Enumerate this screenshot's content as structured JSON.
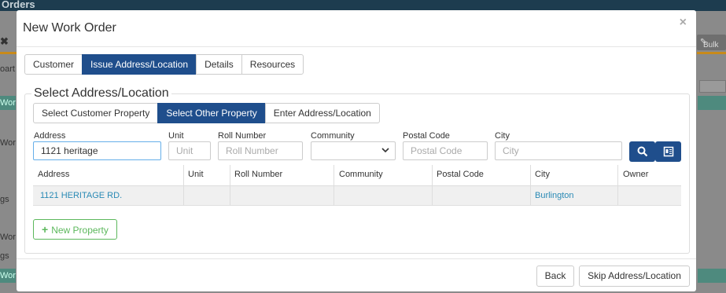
{
  "background": {
    "title_fragment": "Orders",
    "bulk_label": "Bulk",
    "left_fragments": [
      "oart",
      "Wor",
      "Wor",
      "gs",
      "Wor",
      "gs",
      "Wor",
      "Wor"
    ]
  },
  "modal": {
    "title": "New Work Order",
    "close_glyph": "×",
    "tabs": [
      {
        "label": "Customer",
        "active": false
      },
      {
        "label": "Issue Address/Location",
        "active": true
      },
      {
        "label": "Details",
        "active": false
      },
      {
        "label": "Resources",
        "active": false
      }
    ],
    "section_title": "Select Address/Location",
    "subtabs": [
      {
        "label": "Select Customer Property",
        "active": false
      },
      {
        "label": "Select Other Property",
        "active": true
      },
      {
        "label": "Enter Address/Location",
        "active": false
      }
    ],
    "fields": {
      "address": {
        "label": "Address",
        "value": "1121 heritage",
        "placeholder": "Address"
      },
      "unit": {
        "label": "Unit",
        "value": "",
        "placeholder": "Unit"
      },
      "roll_number": {
        "label": "Roll Number",
        "value": "",
        "placeholder": "Roll Number"
      },
      "community": {
        "label": "Community",
        "value": ""
      },
      "postal_code": {
        "label": "Postal Code",
        "value": "",
        "placeholder": "Postal Code"
      },
      "city": {
        "label": "City",
        "value": "",
        "placeholder": "City"
      }
    },
    "search_icon": "search-icon",
    "map_icon": "map-card-icon",
    "table": {
      "columns": [
        "Address",
        "Unit",
        "Roll Number",
        "Community",
        "Postal Code",
        "City",
        "Owner"
      ],
      "rows": [
        {
          "address": "1121 HERITAGE RD.",
          "unit": "",
          "roll_number": "",
          "community": "",
          "postal_code": "",
          "city": "Burlington",
          "owner": ""
        }
      ]
    },
    "new_property_label": "New Property",
    "footer": {
      "back_label": "Back",
      "skip_label": "Skip Address/Location"
    }
  },
  "colors": {
    "primary": "#1f4e8c",
    "success": "#5cb85c",
    "link": "#2a8ab5"
  }
}
